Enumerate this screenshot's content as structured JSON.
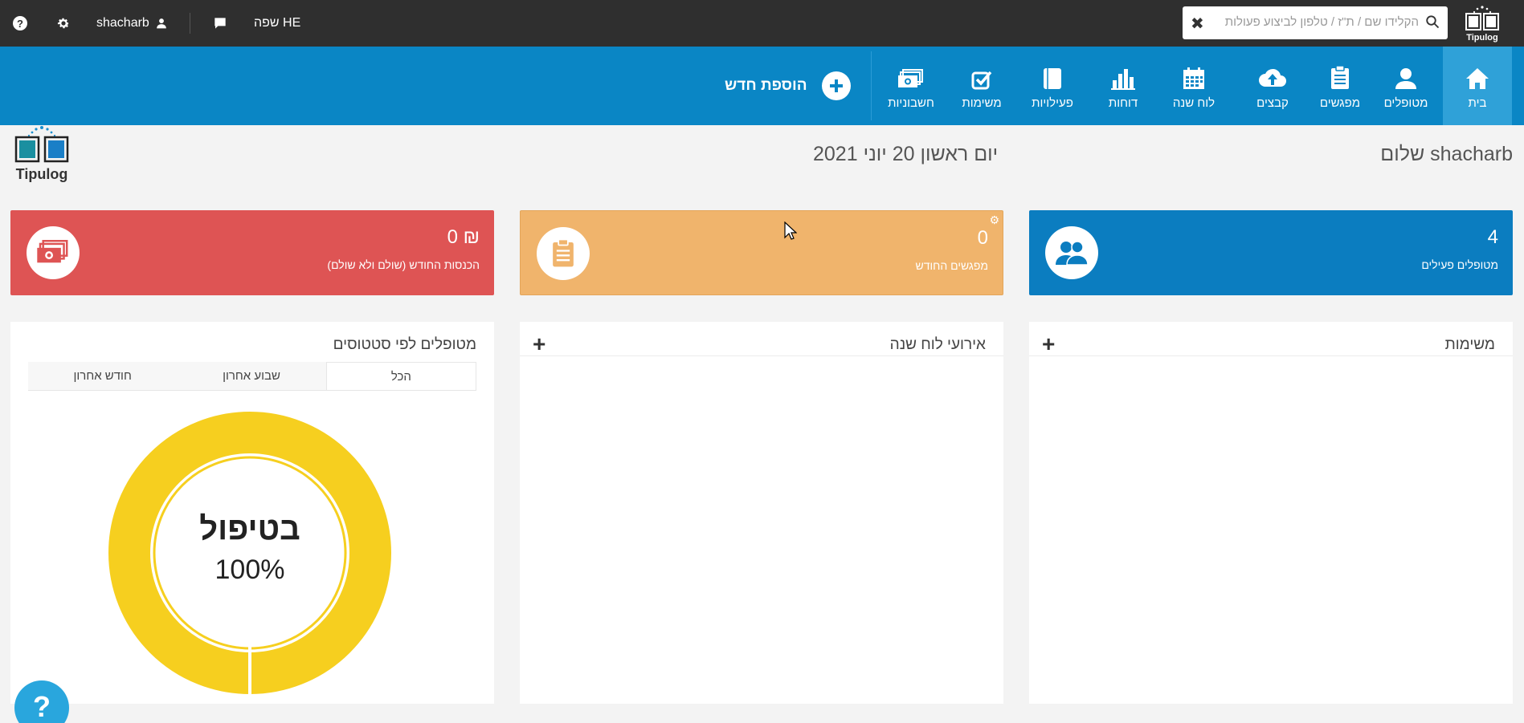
{
  "topbar": {
    "user_name": "shacharb",
    "language": "שפה HE",
    "search_placeholder": "הקלידו שם / ת\"ז / טלפון לביצוע פעולות",
    "logo_text": "Tipulog"
  },
  "nav": {
    "items": [
      {
        "label": "בית",
        "icon": "home-icon"
      },
      {
        "label": "מטופלים",
        "icon": "user-icon"
      },
      {
        "label": "מפגשים",
        "icon": "clipboard-icon"
      },
      {
        "label": "קבצים",
        "icon": "cloud-upload-icon"
      },
      {
        "label": "לוח שנה",
        "icon": "calendar-icon"
      },
      {
        "label": "דוחות",
        "icon": "bar-chart-icon"
      },
      {
        "label": "פעילויות",
        "icon": "book-icon"
      },
      {
        "label": "משימות",
        "icon": "checkbox-icon"
      },
      {
        "label": "חשבוניות",
        "icon": "money-icon"
      }
    ],
    "add_new": "הוספת חדש"
  },
  "header": {
    "greeting": "שלום shacharb",
    "date": "יום ראשון 20 יוני 2021",
    "logo_text": "Tipulog"
  },
  "stats": {
    "income": {
      "value": "0 ₪",
      "label": "הכנסות החודש (שולם ולא שולם)",
      "color": "#de5454"
    },
    "meetings": {
      "value": "0",
      "label": "מפגשים החודש",
      "color": "#f0b46c"
    },
    "patients": {
      "value": "4",
      "label": "מטופלים פעילים",
      "color": "#0b7dc0"
    }
  },
  "panels": {
    "status": {
      "title": "מטופלים לפי סטטוסים",
      "tabs": [
        "הכל",
        "שבוע אחרון",
        "חודש אחרון"
      ],
      "active_tab": "הכל",
      "donut": {
        "label": "בטיפול",
        "percent": "100%",
        "fraction": 1.0,
        "color": "#f6cf1f"
      }
    },
    "calendar": {
      "title": "אירועי לוח שנה"
    },
    "tasks": {
      "title": "משימות"
    }
  },
  "help_fab": "?"
}
